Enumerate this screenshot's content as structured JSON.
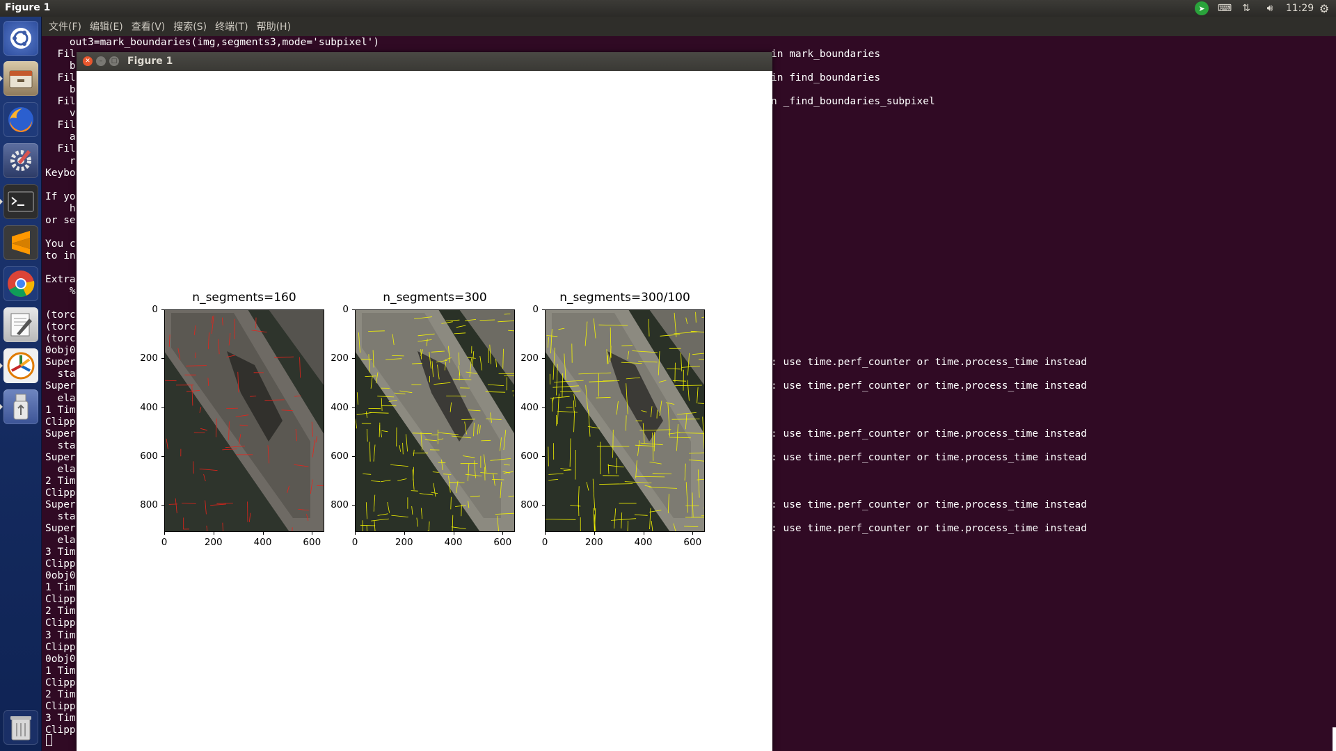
{
  "top_panel": {
    "title": "Figure 1",
    "clock": "11:29"
  },
  "terminal_menu": [
    "文件(F)",
    "编辑(E)",
    "查看(V)",
    "搜索(S)",
    "终端(T)",
    "帮助(H)"
  ],
  "terminal": {
    "left_lines": [
      "    out3=mark_boundaries(img,segments3,mode='subpixel')",
      "  Fil",
      "    b",
      "  Fil",
      "    b",
      "  Fil",
      "    v",
      "  Fil",
      "    a",
      "  Fil",
      "    r",
      "Keybo",
      "",
      "If yo",
      "    h",
      "or se",
      "",
      "You c",
      "to in",
      "",
      "Extra",
      "    %",
      "",
      "(torc",
      "(torc",
      "(torc",
      "0obj0",
      "Super",
      "  sta",
      "Super",
      "  ela",
      "1 Tim",
      "Clipp",
      "Super",
      "  sta",
      "Super",
      "  ela",
      "2 Tim",
      "Clipp",
      "Super",
      "  sta",
      "Super",
      "  ela",
      "3 Tim",
      "Clipp",
      "0obj0",
      "1 Tim",
      "Clipp",
      "2 Tim",
      "Clipp",
      "3 Tim",
      "Clipp",
      "0obj0",
      "1 Tim",
      "Clipp",
      "2 Tim",
      "Clipp",
      "3 Tim",
      "Clipp"
    ],
    "right_lines": [
      {
        "row": 1,
        "text": "in mark_boundaries"
      },
      {
        "row": 3,
        "text": "in find_boundaries"
      },
      {
        "row": 5,
        "text": "n _find_boundaries_subpixel"
      },
      {
        "row": 27,
        "text": ": use time.perf_counter or time.process_time instead"
      },
      {
        "row": 29,
        "text": ": use time.perf_counter or time.process_time instead"
      },
      {
        "row": 33,
        "text": ": use time.perf_counter or time.process_time instead"
      },
      {
        "row": 35,
        "text": ": use time.perf_counter or time.process_time instead"
      },
      {
        "row": 39,
        "text": ": use time.perf_counter or time.process_time instead"
      },
      {
        "row": 41,
        "text": ": use time.perf_counter or time.process_time instead"
      }
    ]
  },
  "figure_window": {
    "title": "Figure 1"
  },
  "panels": [
    {
      "title": "n_segments=160",
      "boundary_color": "#e8231a"
    },
    {
      "title": "n_segments=300",
      "boundary_color": "#f5f500"
    },
    {
      "title": "n_segments=300/100",
      "boundary_color": "#f5f500"
    }
  ],
  "axes": {
    "y_ticks": [
      "0",
      "200",
      "400",
      "600",
      "800"
    ],
    "x_ticks": [
      "0",
      "200",
      "400",
      "600"
    ],
    "x_range": [
      0,
      650
    ],
    "y_range": [
      0,
      910
    ]
  },
  "launcher_icons": [
    "ubuntu-dash-icon",
    "files-icon",
    "firefox-icon",
    "system-settings-icon",
    "terminal-icon",
    "sublime-text-icon",
    "chrome-icon",
    "text-editor-icon",
    "app-icon",
    "usb-drive-icon",
    "trash-icon"
  ]
}
